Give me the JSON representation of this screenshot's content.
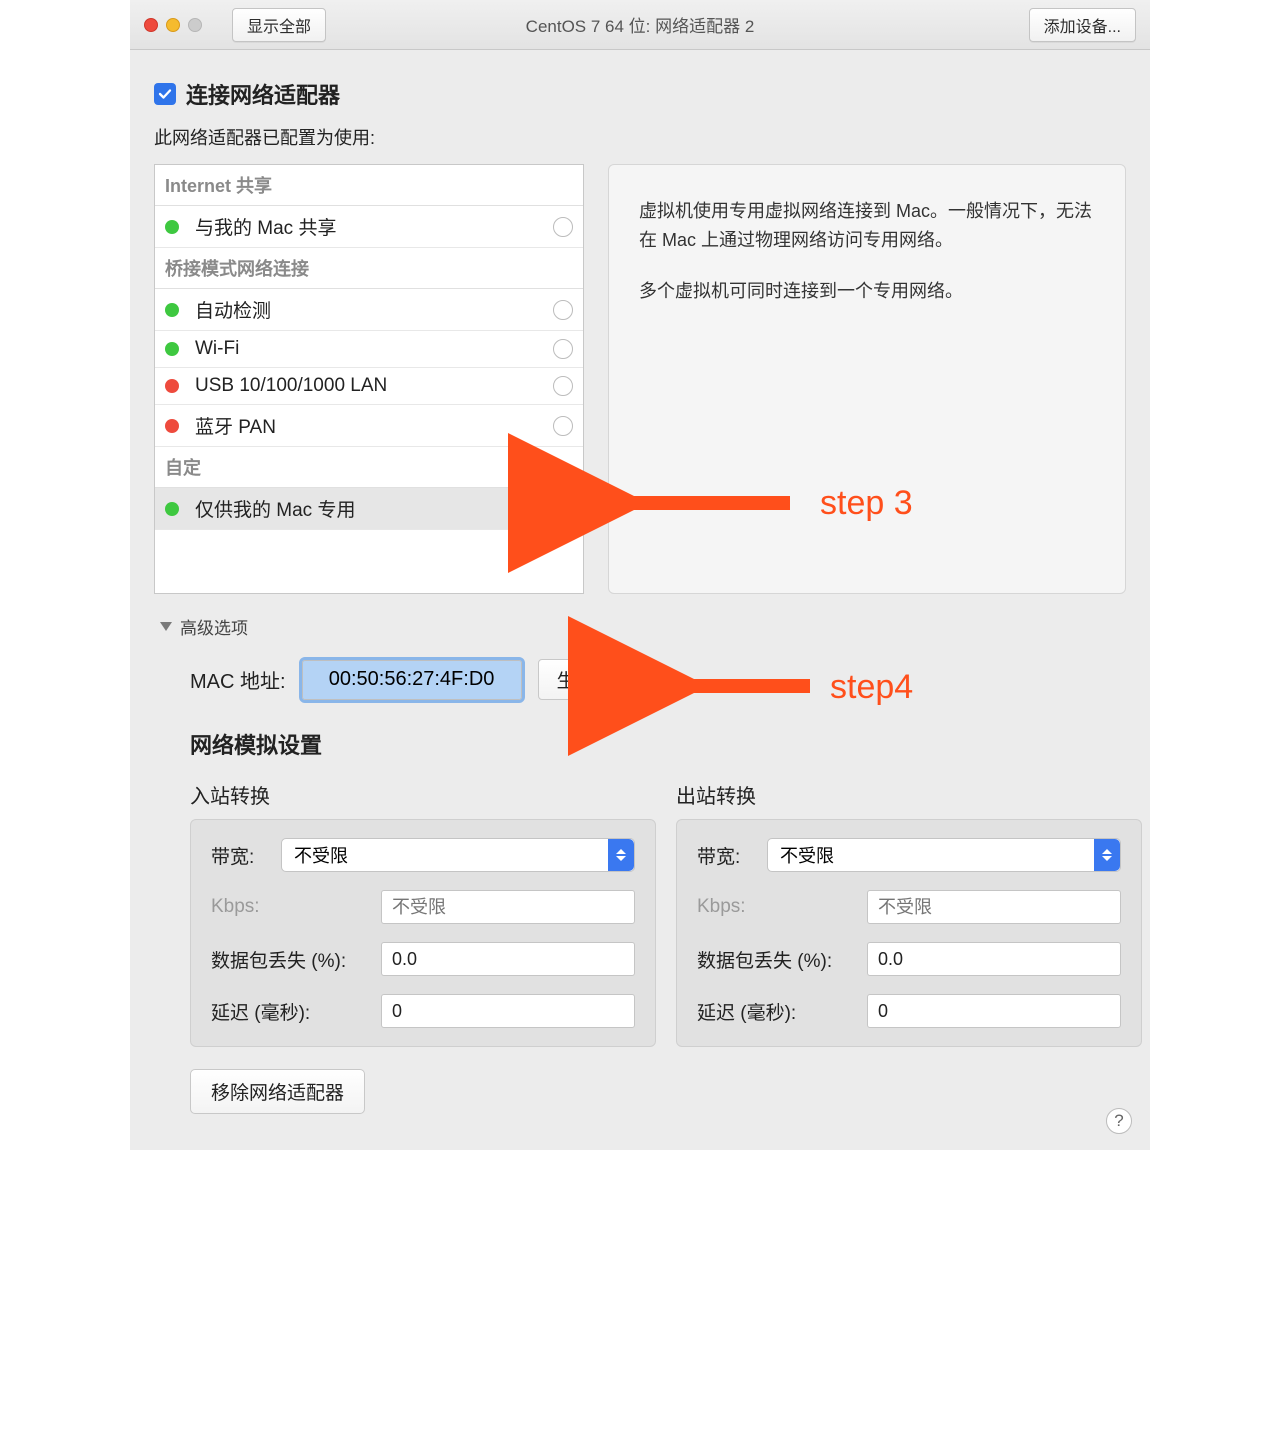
{
  "titlebar": {
    "show_all_label": "显示全部",
    "title": "CentOS 7 64 位: 网络适配器 2",
    "add_device_label": "添加设备..."
  },
  "connect_checkbox": {
    "checked": true,
    "label": "连接网络适配器"
  },
  "configured_label": "此网络适配器已配置为使用:",
  "network_list": {
    "sections": [
      {
        "title": "Internet 共享",
        "items": [
          {
            "label": "与我的 Mac 共享",
            "status": "green",
            "selected": false
          }
        ]
      },
      {
        "title": "桥接模式网络连接",
        "items": [
          {
            "label": "自动检测",
            "status": "green",
            "selected": false
          },
          {
            "label": "Wi-Fi",
            "status": "green",
            "selected": false
          },
          {
            "label": "USB 10/100/1000 LAN",
            "status": "red",
            "selected": false
          },
          {
            "label": "蓝牙 PAN",
            "status": "red",
            "selected": false
          }
        ]
      },
      {
        "title": "自定",
        "items": [
          {
            "label": "仅供我的 Mac 专用",
            "status": "green",
            "selected": true
          }
        ]
      }
    ]
  },
  "description": {
    "p1": "虚拟机使用专用虚拟网络连接到 Mac。一般情况下，无法在 Mac 上通过物理网络访问专用网络。",
    "p2": "多个虚拟机可同时连接到一个专用网络。"
  },
  "advanced": {
    "toggle_label": "高级选项",
    "mac_label": "MAC 地址:",
    "mac_value": "00:50:56:27:4F:D0",
    "generate_label": "生成"
  },
  "simulation": {
    "title": "网络模拟设置",
    "inbound_title": "入站转换",
    "outbound_title": "出站转换",
    "bandwidth_label": "带宽:",
    "bandwidth_value": "不受限",
    "kbps_label": "Kbps:",
    "kbps_placeholder": "不受限",
    "loss_label": "数据包丢失 (%):",
    "loss_value": "0.0",
    "latency_label": "延迟 (毫秒):",
    "latency_value": "0"
  },
  "remove_label": "移除网络适配器",
  "help_label": "?",
  "annotations": {
    "step3": "step 3",
    "step4": "step4"
  }
}
